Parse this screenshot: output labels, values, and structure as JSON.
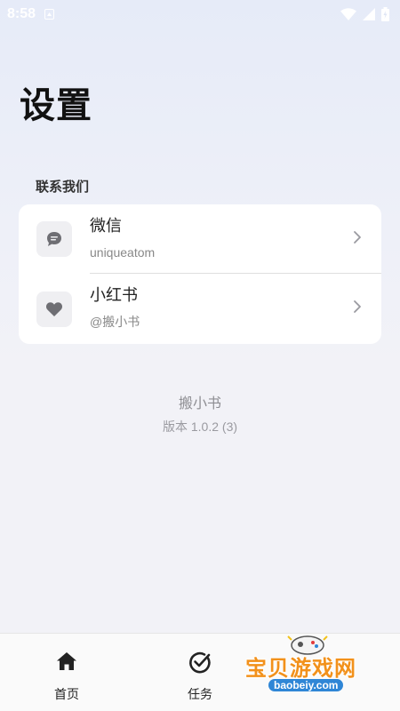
{
  "status_bar": {
    "time": "8:58"
  },
  "header": {
    "title": "设置"
  },
  "contact_section": {
    "label": "联系我们",
    "items": [
      {
        "title": "微信",
        "subtitle": "uniqueatom",
        "icon": "chat-bubble-icon"
      },
      {
        "title": "小红书",
        "subtitle": "@搬小书",
        "icon": "heart-icon"
      }
    ]
  },
  "about": {
    "app_name": "搬小书",
    "version": "版本 1.0.2 (3)"
  },
  "bottom_nav": {
    "items": [
      {
        "label": "首页",
        "icon": "home-icon",
        "active": true
      },
      {
        "label": "任务",
        "icon": "check-circle-icon",
        "active": false
      }
    ]
  },
  "watermark": {
    "text": "宝贝游戏网",
    "url": "baobeiy.com"
  },
  "colors": {
    "accent_watermark": "#f2911b",
    "background": "#f2f2f7",
    "card": "#ffffff"
  }
}
